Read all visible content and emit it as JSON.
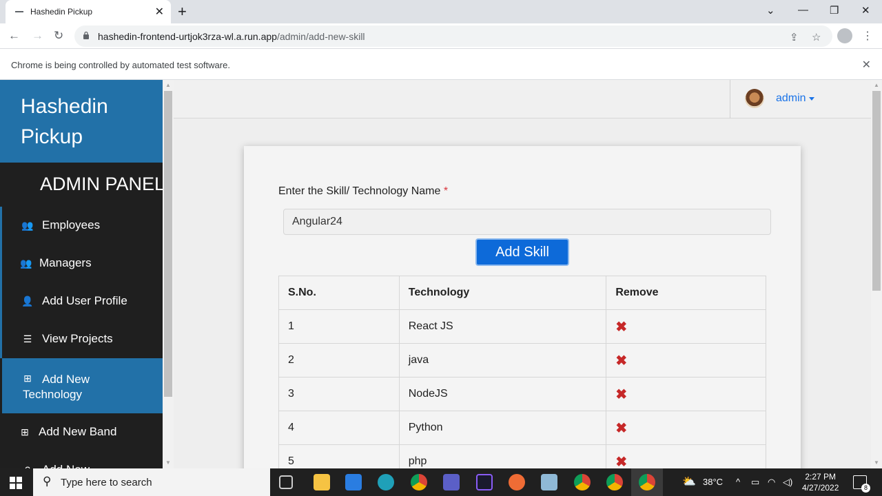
{
  "browser": {
    "tab_title": "Hashedin Pickup",
    "new_tab_symbol": "+",
    "url_host": "hashedin-frontend-urtjok3rza-wl.a.run.app",
    "url_path": "/admin/add-new-skill",
    "infobar_message": "Chrome is being controlled by automated test software."
  },
  "sidebar": {
    "brand_line1": "Hashedin",
    "brand_line2": "Pickup",
    "panel_title": "ADMIN PANEL",
    "items": [
      {
        "label": "Employees",
        "icon": "users-icon"
      },
      {
        "label": "Managers",
        "icon": "users-icon"
      },
      {
        "label": "Add User Profile",
        "icon": "user-plus-icon"
      },
      {
        "label": "View Projects",
        "icon": "list-icon"
      },
      {
        "label_line1": "Add New",
        "label_line2": "Technology",
        "icon": "plus-square-icon",
        "active": true
      },
      {
        "label": "Add New Band",
        "icon": "plus-square-outline-icon"
      },
      {
        "label": "Add New",
        "icon": "question-icon"
      }
    ]
  },
  "header": {
    "user_name": "admin"
  },
  "form": {
    "label": "Enter the Skill/ Technology Name",
    "required_mark": "*",
    "input_value": "Angular24",
    "button_label": "Add Skill"
  },
  "table": {
    "headers": [
      "S.No.",
      "Technology",
      "Remove"
    ],
    "rows": [
      {
        "sno": "1",
        "tech": "React JS"
      },
      {
        "sno": "2",
        "tech": "java"
      },
      {
        "sno": "3",
        "tech": "NodeJS"
      },
      {
        "sno": "4",
        "tech": "Python"
      },
      {
        "sno": "5",
        "tech": "php"
      }
    ],
    "remove_symbol": "✖"
  },
  "taskbar": {
    "search_placeholder": "Type here to search",
    "temperature": "38°C",
    "time": "2:27 PM",
    "date": "4/27/2022",
    "notification_count": "8"
  },
  "colors": {
    "brand_blue": "#2271a8",
    "button_blue": "#0d6ad9",
    "remove_red": "#c62828"
  }
}
